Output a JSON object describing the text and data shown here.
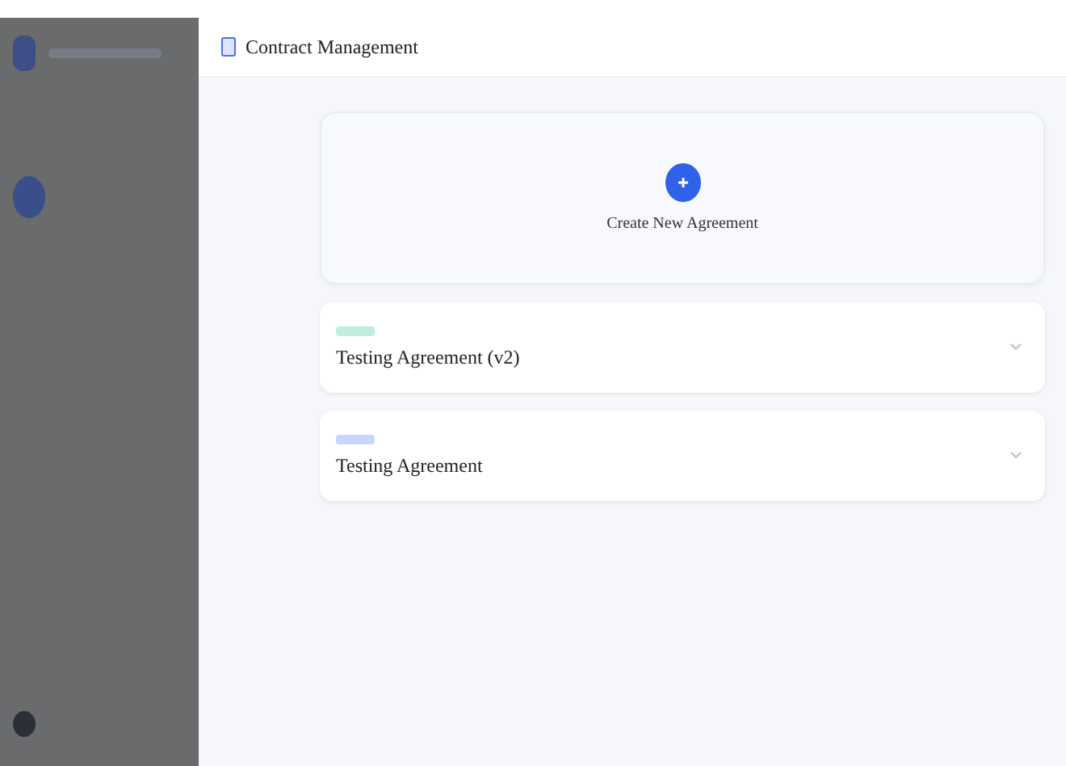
{
  "header": {
    "title": "Contract Management"
  },
  "create_card": {
    "title": "Create New Agreement"
  },
  "agreements": [
    {
      "title": "Testing Agreement (v2)",
      "color": "#bfeedd"
    },
    {
      "title": "Testing Agreement",
      "color": "#c9d6fb"
    }
  ]
}
